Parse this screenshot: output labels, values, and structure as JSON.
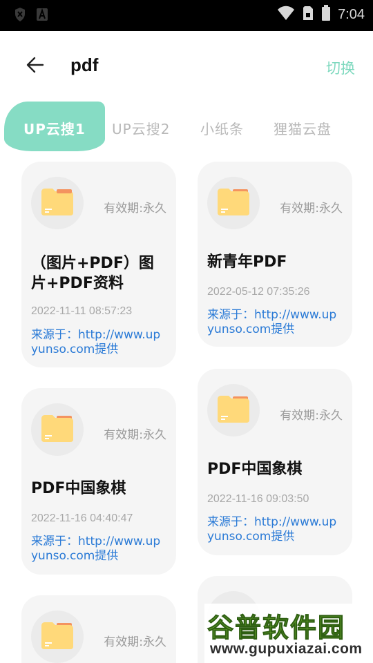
{
  "status_bar": {
    "time": "7:04",
    "icons": [
      "shield-icon",
      "a-icon",
      "wifi-icon",
      "sim-icon",
      "battery-icon"
    ]
  },
  "header": {
    "title": "pdf",
    "switch_label": "切换",
    "back_icon": "arrow-left-icon"
  },
  "tabs": [
    {
      "label": "UP云搜1",
      "active": true
    },
    {
      "label": "UP云搜2",
      "active": false
    },
    {
      "label": "小纸条",
      "active": false
    },
    {
      "label": "狸猫云盘",
      "active": false
    }
  ],
  "colors": {
    "accent": "#86dcc4",
    "link": "#2a7ad6",
    "folder": "#ffd97a"
  },
  "results": [
    {
      "validity": "有效期:永久",
      "title": "（图片+PDF）图片+PDF资料",
      "date": "2022-11-11 08:57:23",
      "source": "来源于：http://www.upyunso.com提供"
    },
    {
      "validity": "有效期:永久",
      "title": "新青年PDF",
      "date": "2022-05-12 07:35:26",
      "source": "来源于：http://www.upyunso.com提供"
    },
    {
      "validity": "有效期:永久",
      "title": "PDF中国象棋",
      "date": "2022-11-16 04:40:47",
      "source": "来源于：http://www.upyunso.com提供"
    },
    {
      "validity": "有效期:永久",
      "title": "PDF中国象棋",
      "date": "2022-11-16 09:03:50",
      "source": "来源于：http://www.upyunso.com提供"
    },
    {
      "validity": "有效期:永久"
    }
  ],
  "watermark": {
    "title": "谷普软件园",
    "url": "www.gupuxiazai.com"
  }
}
